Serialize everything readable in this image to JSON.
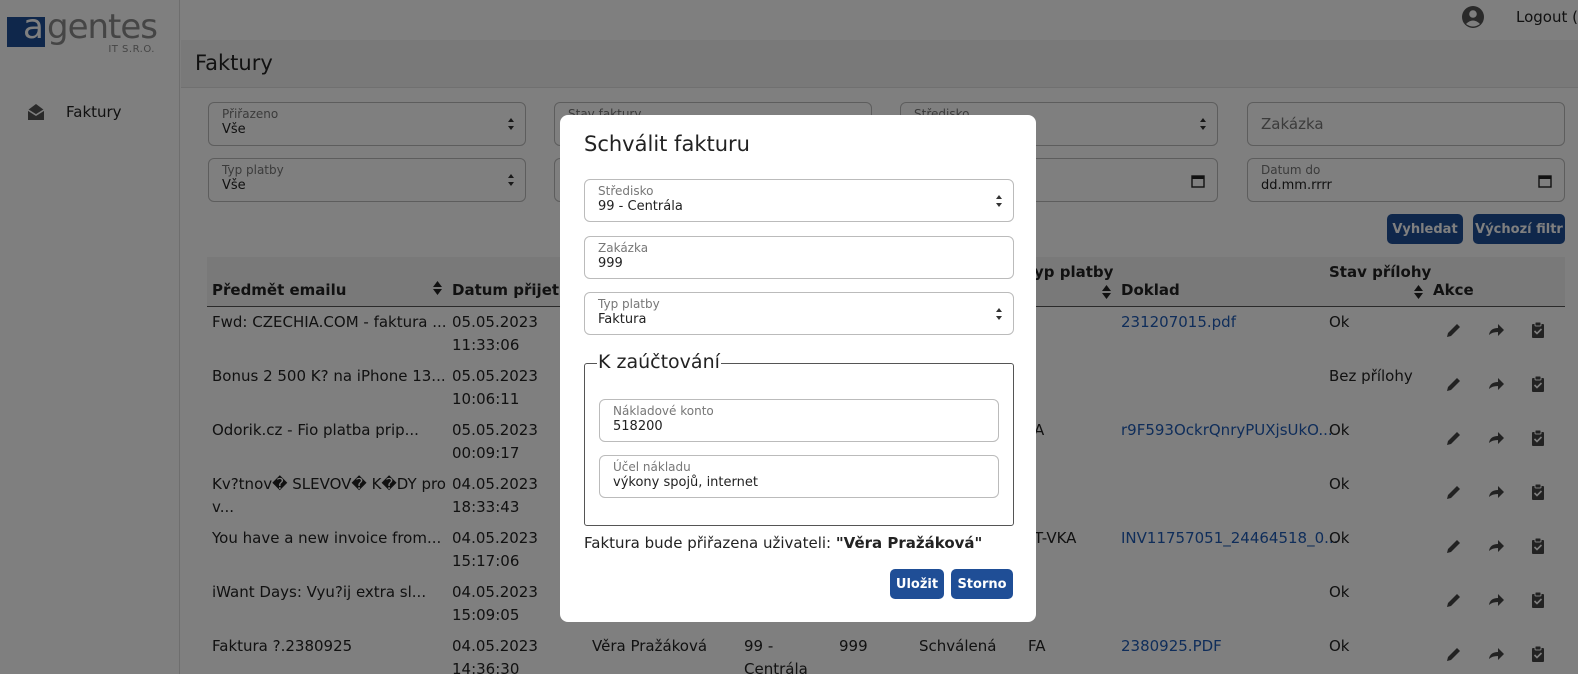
{
  "brand": {
    "logo_letter": "a",
    "logo_rest": "gentes",
    "logo_sub": "IT S.R.O."
  },
  "sidebar": {
    "items": [
      {
        "label": "Faktury",
        "icon": "envelope-open-icon"
      }
    ]
  },
  "topbar": {
    "logout_label": "Logout ("
  },
  "page": {
    "title": "Faktury"
  },
  "filters": {
    "prirazeno": {
      "label": "Přiřazeno",
      "value": "Vše"
    },
    "stav_faktury": {
      "label": "Stav faktury"
    },
    "stredisko": {
      "label": "Středisko"
    },
    "zakazka": {
      "placeholder": "Zakázka"
    },
    "typ_platby": {
      "label": "Typ platby",
      "value": "Vše"
    },
    "datum_do": {
      "label": "Datum do",
      "value": "dd.mm.rrrr"
    },
    "search_button": "Vyhledat",
    "default_filter_button": "Výchozí filtr"
  },
  "table": {
    "headers": {
      "subject": "Předmět emailu",
      "received": "Datum přijetí",
      "payment": "yp platby",
      "doc": "Doklad",
      "att_status_1": "Stav přílohy",
      "actions": "Akce"
    },
    "rows": [
      {
        "subject": "Fwd: CZECHIA.COM - faktura ...",
        "date": "05.05.2023",
        "time": "11:33:06",
        "payment": "",
        "doc": "231207015.pdf",
        "att": "Ok"
      },
      {
        "subject": "Bonus 2 500 K? na iPhone 13...",
        "date": "05.05.2023",
        "time": "10:06:11",
        "payment": "",
        "doc": "",
        "att": "Bez přílohy"
      },
      {
        "subject": "Odorik.cz - Fio platba prip...",
        "date": "05.05.2023",
        "time": "00:09:17",
        "payment": "A",
        "doc": "r9F593OckrQnryPUXjsUkO...",
        "att": "Ok"
      },
      {
        "subject": "Kv?tnov� SLEVOV� K�DY pro",
        "subject2": "v...",
        "date": "04.05.2023",
        "time": "18:33:43",
        "payment": "",
        "doc": "",
        "att": "Ok"
      },
      {
        "subject": "You have a new invoice from...",
        "date": "04.05.2023",
        "time": "15:17:06",
        "payment": "T-VKA",
        "doc": "INV11757051_24464518_0...",
        "att": "Ok"
      },
      {
        "subject": "iWant Days: Vyu?ij extra sl...",
        "date": "04.05.2023",
        "time": "15:09:05",
        "payment": "",
        "doc": "",
        "att": "Ok"
      },
      {
        "subject": "Faktura ?.2380925",
        "date": "04.05.2023",
        "time": "14:36:30",
        "assigned": "Věra Pražáková",
        "center": "99 -",
        "center2": "Centrála",
        "order": "999",
        "state": "Schválená",
        "payment": "FA",
        "doc": "2380925.PDF",
        "att": "Ok"
      }
    ]
  },
  "modal": {
    "title": "Schválit fakturu",
    "stredisko": {
      "label": "Středisko",
      "value": "99 - Centrála"
    },
    "zakazka": {
      "label": "Zakázka",
      "value": "999"
    },
    "typ_platby": {
      "label": "Typ platby",
      "value": "Faktura"
    },
    "fieldset_legend": "K zaúčtování",
    "nakladove_konto": {
      "label": "Nákladové konto",
      "value": "518200"
    },
    "ucel_nakladu": {
      "label": "Účel nákladu",
      "value": "výkony spojů, internet"
    },
    "assign_prefix": "Faktura bude přiřazena uživateli: ",
    "assign_user": "\"Věra Pražáková\"",
    "save_button": "Uložit",
    "cancel_button": "Storno"
  },
  "colors": {
    "primary": "#1f4e96",
    "link": "#1f5bb5",
    "overlay": "rgba(0,0,0,0.5)"
  }
}
